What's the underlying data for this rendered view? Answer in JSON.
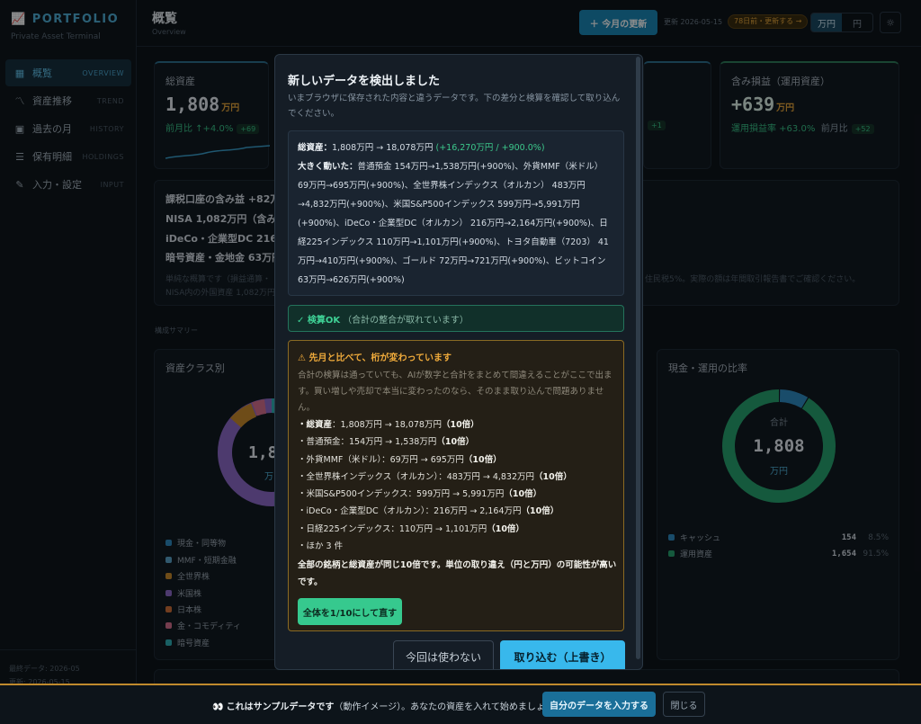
{
  "sidebar": {
    "brand": "PORTFOLIO",
    "brand_sub": "Private Asset Terminal",
    "items": [
      {
        "label": "概覧",
        "en": "OVERVIEW",
        "icon": "grid-icon"
      },
      {
        "label": "資産推移",
        "en": "TREND",
        "icon": "trend-icon"
      },
      {
        "label": "過去の月",
        "en": "HISTORY",
        "icon": "calendar-icon"
      },
      {
        "label": "保有明細",
        "en": "HOLDINGS",
        "icon": "list-icon"
      },
      {
        "label": "入力・設定",
        "en": "INPUT",
        "icon": "pencil-icon"
      }
    ],
    "foot_line1": "最終データ: 2026-05",
    "foot_line2": "更新: 2026-05-15"
  },
  "header": {
    "title": "概覧",
    "subtitle": "Overview",
    "update_button": "＋ 今月の更新",
    "updated_text": "更新 2026-05-15",
    "stale_badge": "78日前・更新する →",
    "unit_man": "万円",
    "unit_yen": "円"
  },
  "kpi": {
    "total_label": "総資産",
    "total_value": "1,808",
    "total_unit": "万円",
    "total_sub": "前月比 ↑+4.0%",
    "total_chip": "+69",
    "mid_chip": "+1",
    "gain_label": "含み損益（運用資産）",
    "gain_value": "+639",
    "gain_unit": "万円",
    "gain_sub": "運用損益率 +63.0%",
    "gain_sub2": "前月比",
    "gain_chip": "+52"
  },
  "tax": {
    "line1": "課税口座の含み益 +82万",
    "line2": "NISA 1,082万円（含み益",
    "line3": "iDeCo・企業型DC 216万円",
    "line4": "暗号資産・金地金 63万円",
    "note1": "単純な概算です（損益通算・",
    "note1_right": "住民税5%。実際の額は年間取引報告書でご確認ください。",
    "note2": "NISA内の外国資産 1,082万円"
  },
  "section_title": "構成サマリー",
  "asset_class": {
    "title": "資産クラス別",
    "center_value": "1,8",
    "center_unit": "万",
    "legend": [
      "現金・同等物",
      "MMF・短期金融",
      "全世界株",
      "米国株",
      "日本株",
      "金・コモディティ",
      "暗号資産"
    ]
  },
  "cash_ratio": {
    "title": "現金・運用の比率",
    "center_label": "合計",
    "center_value": "1,808",
    "center_unit": "万円",
    "rows": [
      {
        "name": "キャッシュ",
        "value": "154",
        "pct": "8.5%"
      },
      {
        "name": "運用資産",
        "value": "1,654",
        "pct": "91.5%"
      }
    ]
  },
  "chart_data": {
    "type": "pie",
    "title": "現金・運用の比率",
    "categories": [
      "キャッシュ",
      "運用資産"
    ],
    "values": [
      154,
      1654
    ],
    "percent": [
      8.5,
      91.5
    ]
  },
  "modal": {
    "title": "新しいデータを検出しました",
    "description": "いまブラウザに保存された内容と違うデータです。下の差分と検算を確認して取り込んでください。",
    "diff_total_label": "総資産：",
    "diff_total": "1,808万円 → 18,078万円",
    "diff_total_change": "(+16,270万円 / +900.0%)",
    "diff_moved_label": "大きく動いた：",
    "diff_moved": "普通預金 154万円→1,538万円(+900%)、外貨MMF（米ドル） 69万円→695万円(+900%)、全世界株インデックス（オルカン） 483万円→4,832万円(+900%)、米国S&P500インデックス 599万円→5,991万円(+900%)、iDeCo・企業型DC（オルカン） 216万円→2,164万円(+900%)、日経225インデックス 110万円→1,101万円(+900%)、トヨタ自動車（7203） 41万円→410万円(+900%)、ゴールド 72万円→721万円(+900%)、ビットコイン 63万円→626万円(+900%)",
    "ok_label": "✓ 検算OK",
    "ok_detail": "（合計の整合が取れています）",
    "warn_title": "⚠ 先月と比べて、桁が変わっています",
    "warn_desc": "合計の検算は通っていても、AIが数字と合計をまとめて間違えることがここで出ます。買い増しや売却で本当に変わったのなら、そのまま取り込んで問題ありません。",
    "warn_items": [
      {
        "label": "・総資産",
        "text": "：1,808万円 → 18,078万円",
        "ratio": "（10倍）"
      },
      {
        "label": "・普通預金",
        "text": "：154万円 → 1,538万円",
        "ratio": "（10倍）"
      },
      {
        "label": "・外貨MMF（米ドル）",
        "text": "：69万円 → 695万円",
        "ratio": "（10倍）"
      },
      {
        "label": "・全世界株インデックス（オルカン）",
        "text": "：483万円 → 4,832万円",
        "ratio": "（10倍）"
      },
      {
        "label": "・米国S&P500インデックス",
        "text": "：599万円 → 5,991万円",
        "ratio": "（10倍）"
      },
      {
        "label": "・iDeCo・企業型DC（オルカン）",
        "text": "：216万円 → 2,164万円",
        "ratio": "（10倍）"
      },
      {
        "label": "・日経225インデックス",
        "text": "：110万円 → 1,101万円",
        "ratio": "（10倍）"
      }
    ],
    "warn_more": "・ほか 3 件",
    "warn_conclusion": "全部の銘柄と総資産が同じ10倍です。単位の取り違え（円と万円）の可能性が高いです。",
    "fix_button": "全体を1/10にして直す",
    "skip_button": "今回は使わない",
    "import_button": "取り込む（上書き）"
  },
  "bottombar": {
    "icon": "👀",
    "text_bold": "これはサンプルデータです",
    "text_rest": "（動作イメージ）。あなたの資産を入れて始めましょう。",
    "cta": "自分のデータを入力する",
    "close": "閉じる"
  },
  "colors": {
    "accent": "#38b8ec",
    "positive": "#3cc98c",
    "warning": "#f0ab3b",
    "legend": [
      "#2f8ac1",
      "#5aa3c9",
      "#c88a2c",
      "#8c6ac9",
      "#d0703a",
      "#d66f8f",
      "#2fb0b7"
    ]
  }
}
